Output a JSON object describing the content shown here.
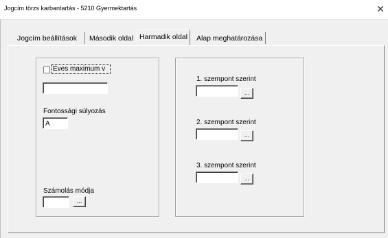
{
  "window": {
    "title": "Jogcím törzs karbantartás - 5210 Gyermektartás",
    "close_glyph": "✕"
  },
  "tabs": [
    {
      "label": "Jogcím beállítások",
      "active": false
    },
    {
      "label": "Második oldal",
      "active": false
    },
    {
      "label": "Harmadik oldal",
      "active": true
    },
    {
      "label": "Alap meghatározása",
      "active": false
    }
  ],
  "left_group": {
    "checkbox_label": "Éves maximum v",
    "checkbox_checked": false,
    "max_value": "",
    "weight_label": "Fontossági súlyozás",
    "weight_value": "A",
    "calc_label": "Számolás módja",
    "calc_value": "",
    "browse_label": "..."
  },
  "right_group": {
    "criteria": [
      {
        "label": "1. szempont szerint",
        "value": "",
        "browse_label": "..."
      },
      {
        "label": "2. szempont szerint",
        "value": "",
        "browse_label": "..."
      },
      {
        "label": "3. szempont szerint",
        "value": "",
        "browse_label": "..."
      }
    ]
  }
}
